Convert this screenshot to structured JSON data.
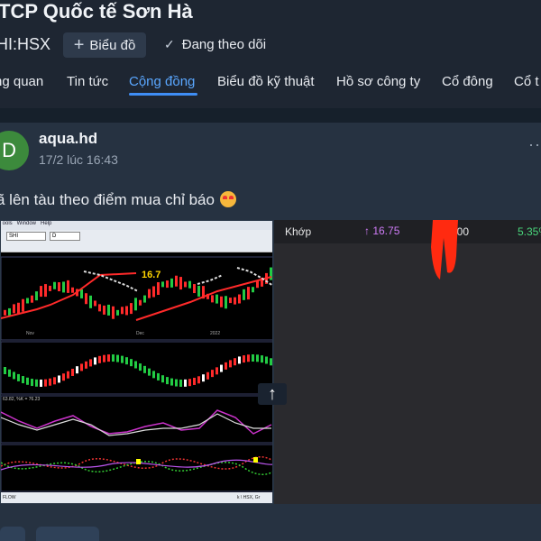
{
  "header": {
    "title": "TCP Quốc tế Sơn Hà",
    "ticker": "HI:HSX",
    "chart_button": "Biểu đồ",
    "follow_label": "Đang theo dõi"
  },
  "tabs": [
    {
      "label": "ng quan"
    },
    {
      "label": "Tin tức"
    },
    {
      "label": "Cộng đồng"
    },
    {
      "label": "Biểu đồ kỹ thuật"
    },
    {
      "label": "Hồ sơ công ty"
    },
    {
      "label": "Cổ đông"
    },
    {
      "label": "Cổ t"
    }
  ],
  "active_tab": "Cộng đồng",
  "post": {
    "avatar_letter": "D",
    "author": "aqua.hd",
    "timestamp": "17/2 lúc 16:43",
    "more_label": "··",
    "text": "ã lên tàu theo điểm mua chỉ báo",
    "emoji": "star-struck-emoji"
  },
  "attached_chart": {
    "price_label": "16.7",
    "months": [
      "Nov",
      "Dec",
      "2022"
    ],
    "indicator_text": "63.82, %K = 76.23",
    "toolbar_symbol": "SHI",
    "toolbar_value": "D",
    "bottom_tab": "FLOW",
    "bottom_right": "k \\ HSX, Gr"
  },
  "quote_panel": {
    "label": "Khớp",
    "price": "↑ 16.75",
    "volume_partial": "000",
    "change_pct": "5.35%"
  },
  "scroll_top_icon": "arrow-up-icon",
  "colors": {
    "accent": "#3f8ef5",
    "up_green": "#4ad77c",
    "price_purple": "#cf7cf7"
  }
}
